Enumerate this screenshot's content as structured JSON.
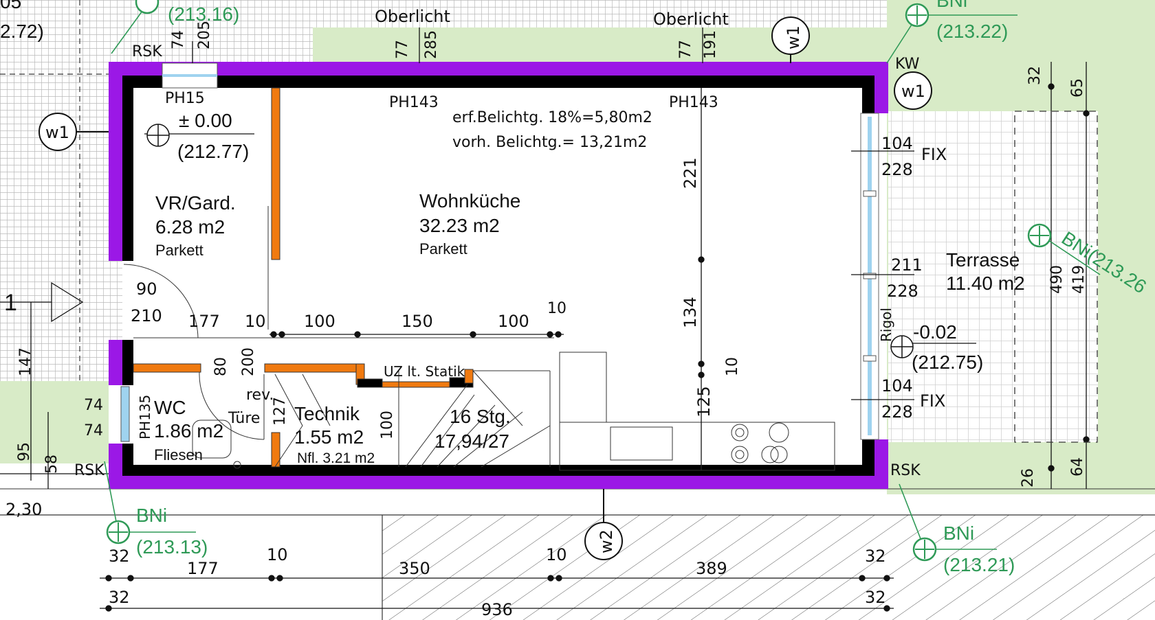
{
  "rooms": {
    "vr": {
      "name": "VR/Gard.",
      "area": "6.28 m2",
      "floor": "Parkett"
    },
    "wohn": {
      "name": "Wohnküche",
      "area": "32.23 m2",
      "floor": "Parkett"
    },
    "wc": {
      "name": "WC",
      "area": "1.86 m2",
      "floor": "Fliesen"
    },
    "technik": {
      "name": "Technik",
      "area": "1.55 m2",
      "net": "Nfl. 3.21 m2"
    },
    "stair": {
      "name": "16 Stg.",
      "ratio": "17,94/27"
    },
    "terrasse": {
      "name": "Terrasse",
      "area": "11.40 m2"
    }
  },
  "notes": {
    "belichtung_req": "erf.Belichtg. 18%=5,80m2",
    "belichtung_have": "vorh. Belichtg.= 13,21m2",
    "oberlicht_1": "Oberlicht",
    "oberlicht_2": "Oberlicht",
    "ph15": "PH15",
    "ph143a": "PH143",
    "ph143b": "PH143",
    "ph135": "PH135",
    "rev_tuere_1": "rev.",
    "rev_tuere_2": "Türe",
    "uz_statik": "UZ lt. Statik",
    "rigol": "Rigol",
    "rsk_top": "RSK",
    "rsk_left": "RSK",
    "rsk_right": "RSK",
    "kw": "KW",
    "fix_1": "FIX",
    "fix_2": "FIX",
    "section_mark": "1"
  },
  "levels": {
    "entrance_value": "± 0.00",
    "entrance_abs": "(212.77)",
    "terrace_value": "-0.02",
    "terrace_abs": "(212.75)",
    "top_left_abs": "(213.16)",
    "top_left_partial": "2.72)",
    "top_left_partial2": "05",
    "bni_top_right_label": "BNi",
    "bni_top_right_abs": "(213.22)",
    "bni_right_label": "BNi(213.26",
    "bni_bottom_left_label": "BNi",
    "bni_bottom_left_abs": "(213.13)",
    "bni_bottom_right_label": "BNi",
    "bni_bottom_right_abs": "(213.21)"
  },
  "markers": {
    "w1_top": "w1",
    "w1_right": "w1",
    "w1_left": "w1",
    "w2_bottom": "w2"
  },
  "dimensions": {
    "top_win_1a": "77",
    "top_win_1b": "285",
    "top_win_2a": "77",
    "top_win_2b": "191",
    "top_left_a": "74",
    "top_left_b": "205",
    "right_win_1a": "104",
    "right_win_1b": "228",
    "right_door_a": "211",
    "right_door_b": "228",
    "right_win_2a": "104",
    "right_win_2b": "228",
    "inner_vert_1": "221",
    "inner_vert_2": "134",
    "inner_vert_3": "10",
    "inner_vert_4": "125",
    "door_90": "90",
    "door_210": "210",
    "inner_177": "177",
    "inner_10a": "10",
    "inner_100a": "100",
    "inner_150": "150",
    "inner_100b": "100",
    "inner_10b": "10",
    "wc_74a": "74",
    "wc_74b": "74",
    "rev_80": "80",
    "rev_200": "200",
    "tech_127": "127",
    "tech_100": "100",
    "left_147": "147",
    "left_95": "95",
    "left_58": "58",
    "left_230": "2,30",
    "terr_32": "32",
    "terr_65": "65",
    "terr_490": "490",
    "terr_419": "419",
    "terr_26": "26",
    "terr_64": "64",
    "bot_32a": "32",
    "bot_177": "177",
    "bot_10a": "10",
    "bot_350": "350",
    "bot_10b": "10",
    "bot_389": "389",
    "bot_32b": "32",
    "bot_32c": "32",
    "bot_32d": "32",
    "bot_936": "936"
  },
  "colors": {
    "wall_purple": "#9b18e6",
    "wall_black": "#000000",
    "partition_orange": "#f07a10",
    "green_fill": "#d8ebc7",
    "annotation_green": "#2f9a57",
    "window_blue": "#9fd3ef"
  }
}
